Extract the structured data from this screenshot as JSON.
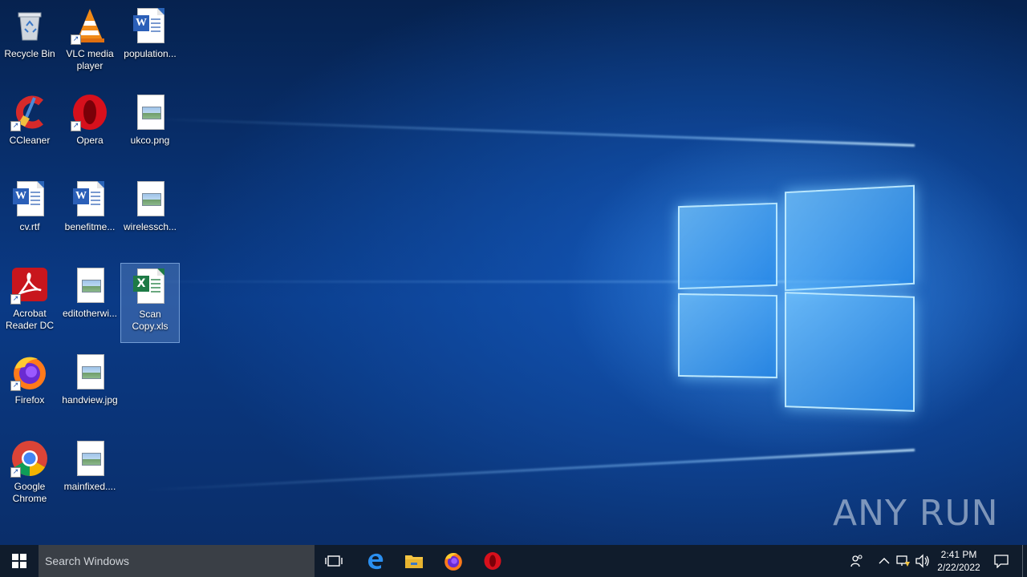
{
  "desktop": {
    "icons": [
      {
        "label": "Recycle Bin",
        "icon": "recycle-bin-icon",
        "shortcut": false
      },
      {
        "label": "VLC media player",
        "icon": "vlc-icon",
        "shortcut": true
      },
      {
        "label": "population...",
        "icon": "word-document-icon",
        "shortcut": false
      },
      {
        "label": "CCleaner",
        "icon": "ccleaner-icon",
        "shortcut": true
      },
      {
        "label": "Opera",
        "icon": "opera-icon",
        "shortcut": true
      },
      {
        "label": "ukco.png",
        "icon": "image-file-icon",
        "shortcut": false
      },
      {
        "label": "cv.rtf",
        "icon": "word-document-icon",
        "shortcut": false
      },
      {
        "label": "benefitme...",
        "icon": "word-document-icon",
        "shortcut": false
      },
      {
        "label": "wirelessch...",
        "icon": "image-file-icon",
        "shortcut": false
      },
      {
        "label": "Acrobat Reader DC",
        "icon": "acrobat-reader-icon",
        "shortcut": true
      },
      {
        "label": "editotherwi...",
        "icon": "image-file-icon",
        "shortcut": false
      },
      {
        "label": "Scan Copy.xls",
        "icon": "excel-document-icon",
        "shortcut": false,
        "selected": true
      },
      {
        "label": "Firefox",
        "icon": "firefox-icon",
        "shortcut": true
      },
      {
        "label": "handview.jpg",
        "icon": "image-file-icon",
        "shortcut": false
      },
      {
        "label": "Google Chrome",
        "icon": "chrome-icon",
        "shortcut": true
      },
      {
        "label": "mainfixed....",
        "icon": "image-file-icon",
        "shortcut": false
      }
    ]
  },
  "taskbar": {
    "search_placeholder": "Search Windows",
    "pinned": [
      {
        "name": "task-view-icon"
      },
      {
        "name": "edge-icon"
      },
      {
        "name": "file-explorer-icon"
      },
      {
        "name": "firefox-icon"
      },
      {
        "name": "opera-icon"
      }
    ],
    "clock": {
      "time": "2:41 PM",
      "date": "2/22/2022"
    }
  },
  "watermark": {
    "text": "ANY RUN"
  },
  "colors": {
    "taskbar": "#101c2c",
    "search_box": "#3a3f46",
    "desktop_accent": "#0a3a86"
  }
}
